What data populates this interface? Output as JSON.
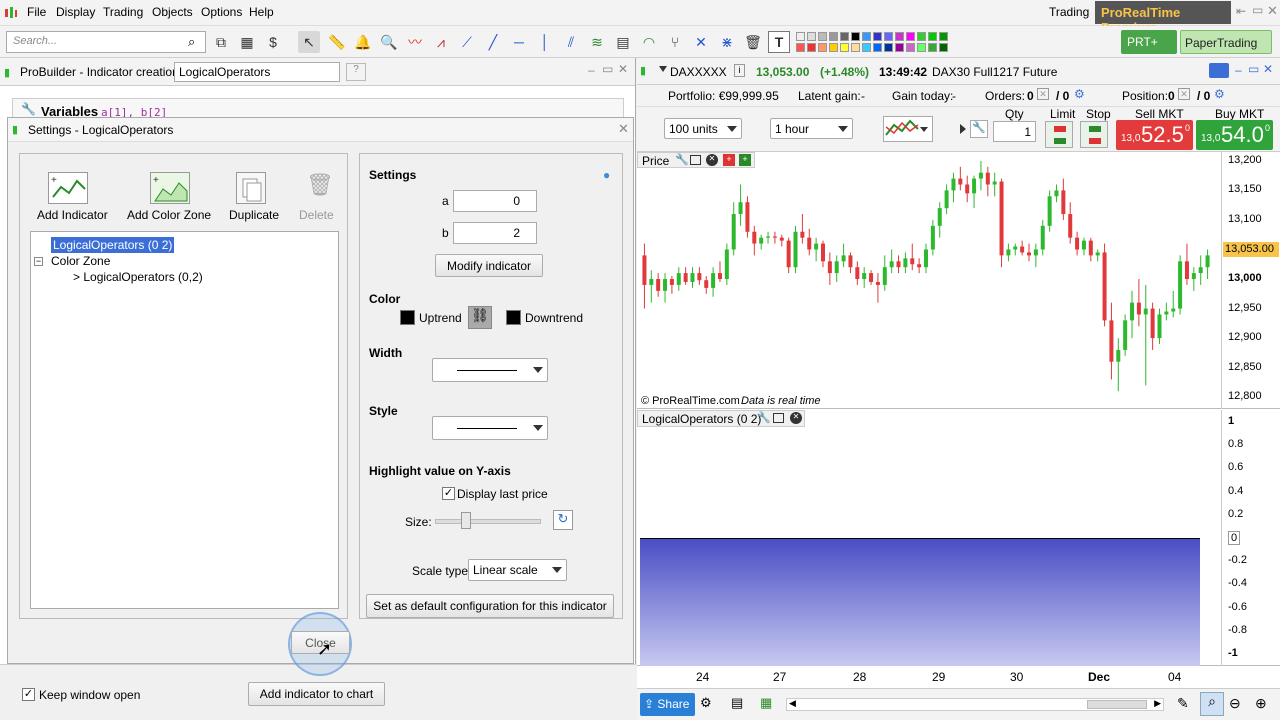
{
  "menu": {
    "items": [
      "File",
      "Display",
      "Trading",
      "Objects",
      "Options",
      "Help"
    ],
    "trading_label": "Trading",
    "premium": "ProRealTime Premium"
  },
  "toolbar": {
    "search_placeholder": "Search...",
    "prt_plus": "PRT+",
    "paper_trading": "PaperTrading"
  },
  "probuilder": {
    "title": "ProBuilder - Indicator creation",
    "name_value": "LogicalOperators",
    "variables_label": "Variables",
    "variables_hint": "a[1], b[2]"
  },
  "dialog": {
    "title": "Settings - LogicalOperators",
    "actions": [
      "Add Indicator",
      "Add Color Zone",
      "Duplicate",
      "Delete"
    ],
    "tree": {
      "root": "LogicalOperators (0 2)",
      "color_zone": "Color Zone",
      "child": "> LogicalOperators (0,2)"
    },
    "settings_title": "Settings",
    "a_label": "a",
    "a_value": "0",
    "b_label": "b",
    "b_value": "2",
    "modify_button": "Modify indicator",
    "color_title": "Color",
    "uptrend": "Uptrend",
    "downtrend": "Downtrend",
    "width_title": "Width",
    "style_title": "Style",
    "highlight_title": "Highlight value on Y-axis",
    "display_last_price": "Display last price",
    "size_label": "Size:",
    "scale_type_label": "Scale type",
    "scale_type_value": "Linear scale",
    "default_config_button": "Set as default configuration for this indicator",
    "close_button": "Close"
  },
  "footer": {
    "keep_open": "Keep window open",
    "add_indicator": "Add indicator to chart"
  },
  "instrument": {
    "symbol": "DAXXXXX",
    "price": "13,053.00",
    "change": "(+1.48%)",
    "time": "13:49:42",
    "name": "DAX30 Full1217 Future"
  },
  "portfolio": {
    "portfolio": "Portfolio: €99,999.95",
    "latent_gain": "Latent gain:",
    "latent_value": "-",
    "gain_today": "Gain today:",
    "gain_value": "-",
    "orders": "Orders:",
    "orders_value": "0",
    "orders_value2": "/ 0",
    "position": "Position:",
    "position_value": "0",
    "position_value2": "/ 0"
  },
  "order": {
    "units": "100 units",
    "timeframe": "1 hour",
    "qty_label": "Qty",
    "qty_value": "1",
    "limit": "Limit",
    "stop": "Stop",
    "sell_label": "Sell MKT",
    "sell_prefix": "13,0",
    "sell_big": "52.5",
    "sell_sup": "0",
    "buy_label": "Buy MKT",
    "buy_prefix": "13,0",
    "buy_big": "54.0",
    "buy_sup": "0"
  },
  "price_chart": {
    "label": "Price",
    "copyright": "© ProRealTime.com",
    "realtime": "Data is real time",
    "last_price": "13,053.00",
    "y_ticks": [
      "13,200",
      "13,150",
      "13,100",
      "13,050",
      "13,000",
      "12,950",
      "12,900",
      "12,850",
      "12,800"
    ]
  },
  "indicator_chart": {
    "label": "LogicalOperators (0 2)",
    "y_ticks": [
      "1",
      "0.8",
      "0.6",
      "0.4",
      "0.2",
      "0",
      "-0.2",
      "-0.4",
      "-0.6",
      "-0.8",
      "-1"
    ]
  },
  "x_axis": {
    "ticks": [
      "24",
      "27",
      "28",
      "29",
      "30",
      "Dec",
      "04"
    ]
  },
  "bottom": {
    "share": "Share"
  },
  "colors": {
    "bull": "#2db82d",
    "bear": "#e0383b",
    "accent": "#3b6fd6"
  },
  "chart_data": {
    "type": "candlestick",
    "y_range": [
      12780,
      13215
    ],
    "candles": [
      [
        13040,
        13060,
        12950,
        12990
      ],
      [
        12990,
        13015,
        12960,
        13000
      ],
      [
        13000,
        13010,
        12970,
        12980
      ],
      [
        12980,
        13010,
        12960,
        13000
      ],
      [
        13000,
        13005,
        12975,
        12990
      ],
      [
        12990,
        13020,
        12980,
        13010
      ],
      [
        13010,
        13020,
        12990,
        12995
      ],
      [
        12995,
        13020,
        12985,
        13010
      ],
      [
        13010,
        13020,
        12990,
        12998
      ],
      [
        12998,
        13005,
        12975,
        12985
      ],
      [
        12985,
        13020,
        12970,
        13010
      ],
      [
        13010,
        13030,
        12995,
        13000
      ],
      [
        13000,
        13060,
        12990,
        13050
      ],
      [
        13050,
        13130,
        13040,
        13110
      ],
      [
        13110,
        13160,
        13090,
        13130
      ],
      [
        13130,
        13140,
        13070,
        13080
      ],
      [
        13080,
        13090,
        13040,
        13060
      ],
      [
        13060,
        13075,
        13050,
        13070
      ],
      [
        13070,
        13080,
        13060,
        13072
      ],
      [
        13072,
        13080,
        13060,
        13070
      ],
      [
        13070,
        13075,
        13055,
        13065
      ],
      [
        13065,
        13070,
        13010,
        13020
      ],
      [
        13020,
        13090,
        13010,
        13080
      ],
      [
        13080,
        13110,
        13060,
        13070
      ],
      [
        13070,
        13085,
        13040,
        13050
      ],
      [
        13050,
        13070,
        13030,
        13060
      ],
      [
        13060,
        13065,
        13020,
        13030
      ],
      [
        13030,
        13045,
        12990,
        13010
      ],
      [
        13010,
        13040,
        12995,
        13030
      ],
      [
        13030,
        13060,
        13020,
        13040
      ],
      [
        13040,
        13045,
        13010,
        13020
      ],
      [
        13020,
        13030,
        12990,
        13000
      ],
      [
        13000,
        13020,
        12985,
        13010
      ],
      [
        13010,
        13015,
        12990,
        12995
      ],
      [
        12995,
        13010,
        12960,
        12990
      ],
      [
        12990,
        13040,
        12980,
        13020
      ],
      [
        13020,
        13050,
        13010,
        13030
      ],
      [
        13030,
        13040,
        13010,
        13020
      ],
      [
        13020,
        13045,
        13010,
        13035
      ],
      [
        13035,
        13060,
        13015,
        13025
      ],
      [
        13025,
        13035,
        13010,
        13020
      ],
      [
        13020,
        13060,
        13010,
        13050
      ],
      [
        13050,
        13100,
        13040,
        13090
      ],
      [
        13090,
        13130,
        13070,
        13120
      ],
      [
        13120,
        13160,
        13110,
        13150
      ],
      [
        13150,
        13180,
        13130,
        13170
      ],
      [
        13170,
        13190,
        13150,
        13160
      ],
      [
        13160,
        13175,
        13130,
        13145
      ],
      [
        13145,
        13175,
        13120,
        13170
      ],
      [
        13170,
        13200,
        13150,
        13180
      ],
      [
        13180,
        13190,
        13140,
        13160
      ],
      [
        13160,
        13180,
        13140,
        13165
      ],
      [
        13165,
        13170,
        13020,
        13040
      ],
      [
        13040,
        13060,
        13030,
        13050
      ],
      [
        13050,
        13060,
        13040,
        13055
      ],
      [
        13055,
        13065,
        13040,
        13045
      ],
      [
        13045,
        13060,
        13030,
        13040
      ],
      [
        13040,
        13060,
        13020,
        13050
      ],
      [
        13050,
        13100,
        13040,
        13090
      ],
      [
        13090,
        13150,
        13080,
        13140
      ],
      [
        13140,
        13160,
        13130,
        13150
      ],
      [
        13150,
        13170,
        13100,
        13110
      ],
      [
        13110,
        13130,
        13060,
        13070
      ],
      [
        13070,
        13080,
        13040,
        13050
      ],
      [
        13050,
        13070,
        13040,
        13065
      ],
      [
        13065,
        13070,
        13030,
        13040
      ],
      [
        13040,
        13050,
        13030,
        13045
      ],
      [
        13045,
        13060,
        12920,
        12930
      ],
      [
        12930,
        12960,
        12830,
        12860
      ],
      [
        12860,
        12900,
        12810,
        12880
      ],
      [
        12880,
        12940,
        12870,
        12930
      ],
      [
        12930,
        12980,
        12900,
        12960
      ],
      [
        12960,
        13000,
        12920,
        12940
      ],
      [
        12940,
        12990,
        12820,
        12950
      ],
      [
        12950,
        12960,
        12880,
        12900
      ],
      [
        12900,
        12950,
        12890,
        12940
      ],
      [
        12940,
        12960,
        12930,
        12945
      ],
      [
        12945,
        12980,
        12935,
        12950
      ],
      [
        12950,
        13040,
        12940,
        13030
      ],
      [
        13030,
        13060,
        12990,
        13000
      ],
      [
        13000,
        13020,
        12980,
        13010
      ],
      [
        13010,
        13040,
        12990,
        13020
      ],
      [
        13020,
        13050,
        13000,
        13040
      ]
    ]
  }
}
